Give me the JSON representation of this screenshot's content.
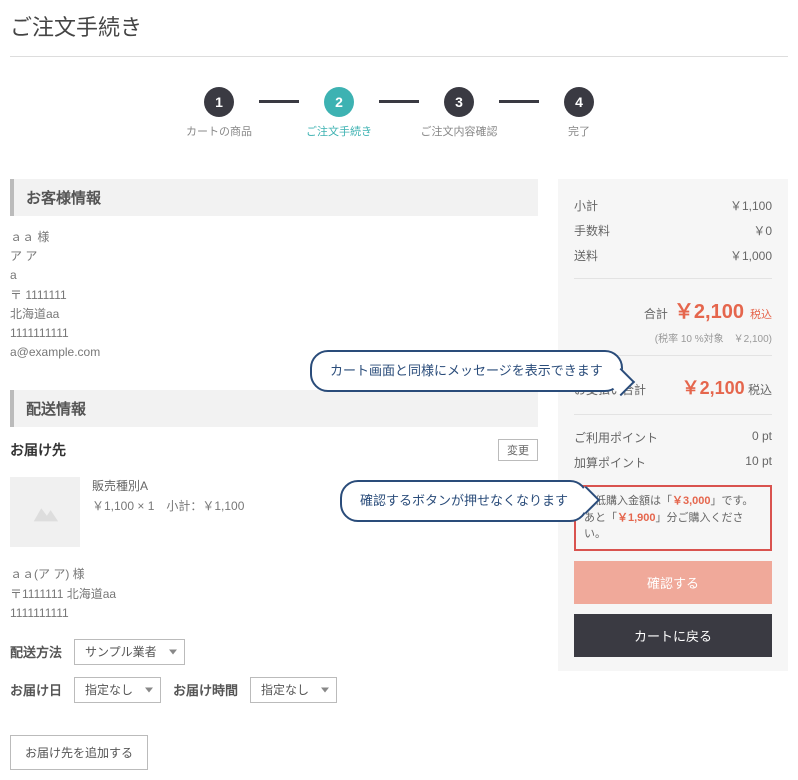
{
  "page_title": "ご注文手続き",
  "stepper": {
    "steps": [
      {
        "num": "1",
        "label": "カートの商品"
      },
      {
        "num": "2",
        "label": "ご注文手続き"
      },
      {
        "num": "3",
        "label": "ご注文内容確認"
      },
      {
        "num": "4",
        "label": "完了"
      }
    ],
    "active_index": 1
  },
  "customer": {
    "section_title": "お客様情報",
    "name_line": "ａａ 様",
    "kana": "ア ア",
    "something": "a",
    "postal": "〒 1111111",
    "address": "北海道aa",
    "phone": "1111111111",
    "email": "a@example.com"
  },
  "shipping": {
    "section_title": "配送情報",
    "dest_label": "お届け先",
    "change_btn": "変更",
    "product": {
      "name": "販売種別A",
      "price_line": "￥1,100 × 1　小計：￥1,100"
    },
    "addr": {
      "name": "ａａ(ア ア) 様",
      "postal_addr": "〒1111111 北海道aa",
      "phone": "1111111111"
    },
    "method_label": "配送方法",
    "method_value": "サンプル業者",
    "date_label": "お届け日",
    "date_value": "指定なし",
    "time_label": "お届け時間",
    "time_value": "指定なし",
    "add_btn": "お届け先を追加する"
  },
  "summary": {
    "rows": [
      {
        "label": "小計",
        "value": "￥1,100"
      },
      {
        "label": "手数料",
        "value": "￥0"
      },
      {
        "label": "送料",
        "value": "￥1,000"
      }
    ],
    "total_label": "合計",
    "total_value": "￥2,100",
    "tax_suffix": "税込",
    "tax_note": "(税率 10 %対象　￥2,100)",
    "pay_label": "お支払い合計",
    "pay_value": "￥2,100",
    "points": [
      {
        "label": "ご利用ポイント",
        "value": "0 pt"
      },
      {
        "label": "加算ポイント",
        "value": "10 pt"
      }
    ],
    "min_purchase": {
      "line1_a": "最低購入金額は「",
      "line1_b": "￥3,000",
      "line1_c": "」です。",
      "line2_a": "あと「",
      "line2_b": "￥1,900",
      "line2_c": "」分ご購入ください。"
    },
    "confirm_btn": "確認する",
    "back_btn": "カートに戻る"
  },
  "callouts": {
    "c1": "カート画面と同様にメッセージを表示できます",
    "c2": "確認するボタンが押せなくなります"
  }
}
